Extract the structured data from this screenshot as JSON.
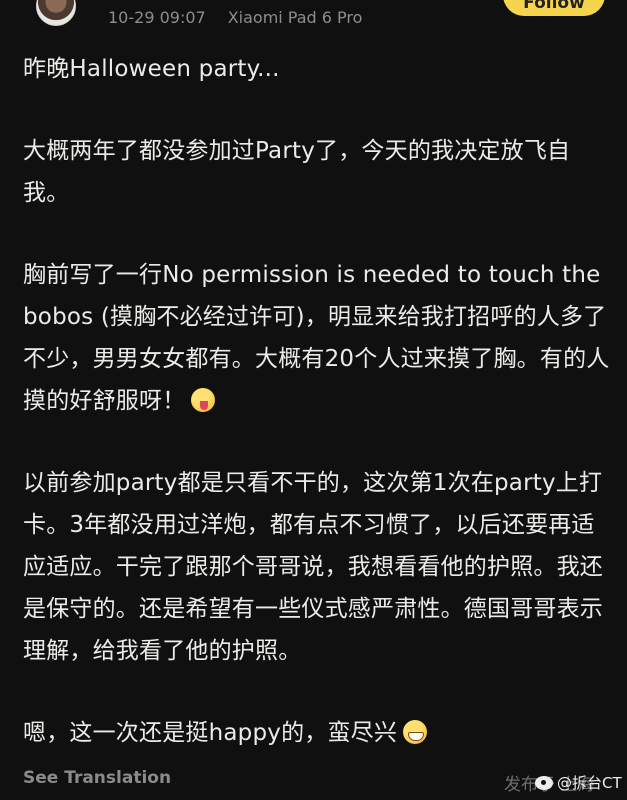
{
  "header": {
    "timestamp": "10-29 09:07",
    "device": "Xiaomi Pad 6 Pro",
    "follow_label": "Follow"
  },
  "post": {
    "paragraphs": [
      "昨晚Halloween party...",
      "大概两年了都没参加过Party了，今天的我决定放飞自我。",
      "胸前写了一行No permission is needed to touch the bobos (摸胸不必经过许可)，明显来给我打招呼的人多了不少，男男女女都有。大概有20个人过来摸了胸。有的人摸的好舒服呀！",
      "以前参加party都是只看不干的，这次第1次在party上打卡。3年都没用过洋炮，都有点不习惯了，以后还要再适应适应。干完了跟那个哥哥说，我想看看他的护照。我还是保守的。还是希望有一些仪式感严肃性。德国哥哥表示理解，给我看了他的护照。",
      "嗯，这一次还是挺happy的，蛮尽兴"
    ],
    "emoji_p3": "tongue-face-emoji",
    "emoji_p5": "grin-face-emoji"
  },
  "footer": {
    "see_translation": "See Translation",
    "location": "发布于 上海",
    "watermark": "@拆台CT"
  },
  "colors": {
    "background": "#101010",
    "text": "#ecebe8",
    "muted": "#8d8d8d",
    "accent": "#f6d54e"
  }
}
